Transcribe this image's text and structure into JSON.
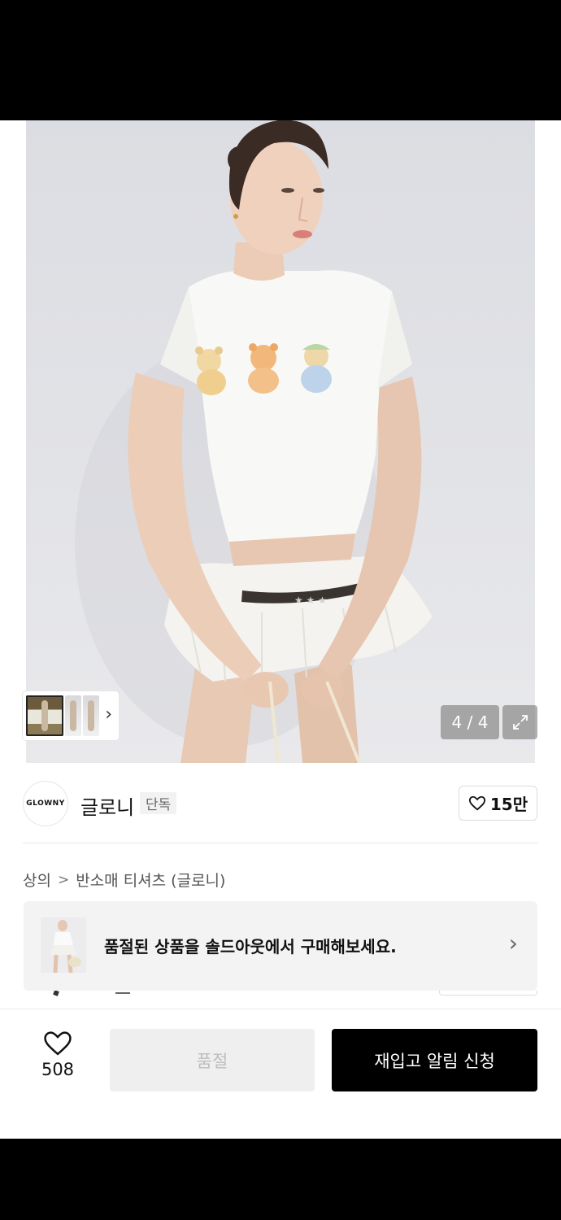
{
  "gallery": {
    "counter": "4 / 4",
    "current_index": 4,
    "total": 4
  },
  "brand": {
    "logo_text": "GLOWNY",
    "name": "글로니",
    "badge": "단독",
    "like_count": "15만"
  },
  "breadcrumb": {
    "category": "상의",
    "subcategory": "반소매 티셔츠 (글로니)"
  },
  "soldout_banner": {
    "text": "품절된 상품을 솔드아웃에서 구매해보세요."
  },
  "action_bar": {
    "wish_count": "508",
    "soldout_label": "품절",
    "restock_label": "재입고 알림 신청"
  },
  "icons": {
    "heart": "heart-icon",
    "expand": "expand-icon",
    "chevron": "chevron-right-icon"
  }
}
